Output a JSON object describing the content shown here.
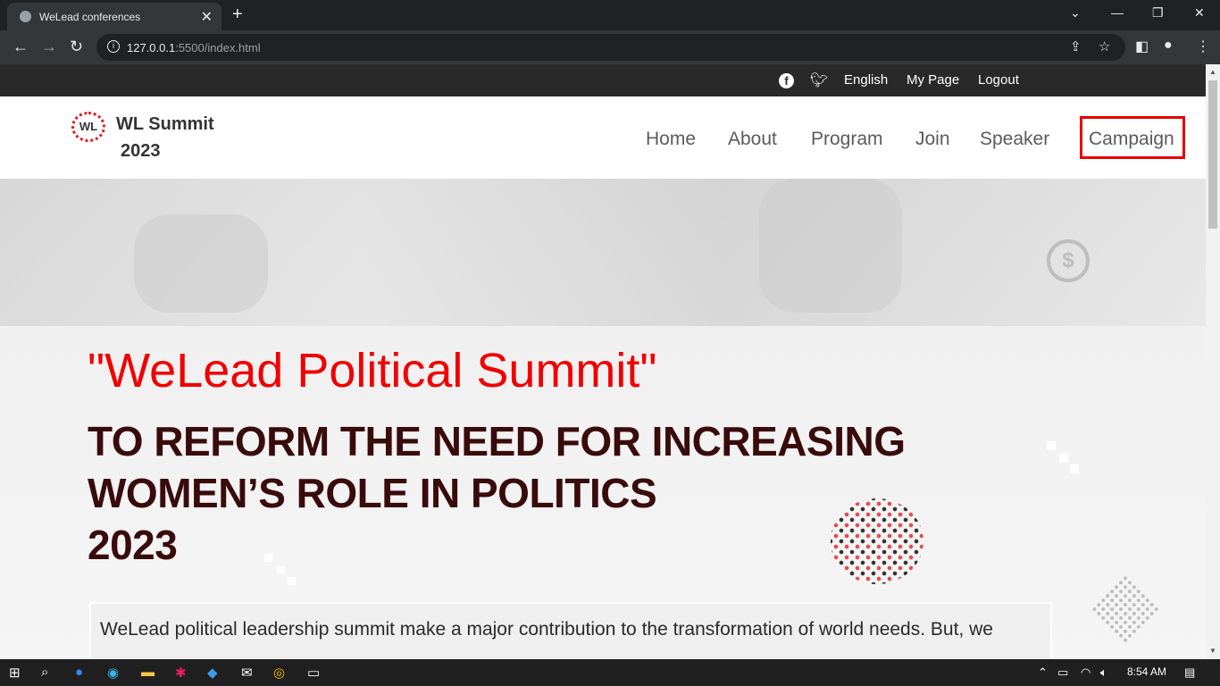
{
  "browser": {
    "tab_title": "WeLead conferences",
    "tab_close": "✕",
    "new_tab": "+",
    "url_host": "127.0.0.1",
    "url_rest": ":5500/index.html",
    "window_controls": [
      "⌄",
      "—",
      "❐",
      "✕"
    ]
  },
  "topbar": {
    "links": [
      "English",
      "My Page",
      "Logout"
    ]
  },
  "header": {
    "logo_text": "WL",
    "brand_line1": "WL Summit",
    "brand_line2": "2023",
    "nav": [
      "Home",
      "About",
      "Program",
      "Join",
      "Speaker",
      "Campaign"
    ]
  },
  "hero": {
    "quote": "\"WeLead Political Summit\"",
    "headline": [
      "TO REFORM THE NEED FOR INCREASING",
      "WOMEN’S ROLE IN POLITICS",
      "2023"
    ],
    "paragraph": "WeLead political leadership summit make a major contribution to the transformation of world needs. But, we"
  },
  "taskbar": {
    "time": "8:54 AM"
  },
  "colors": {
    "accent_red": "#f00000",
    "campaign_border": "#e60000",
    "topbar_bg": "#292929"
  }
}
